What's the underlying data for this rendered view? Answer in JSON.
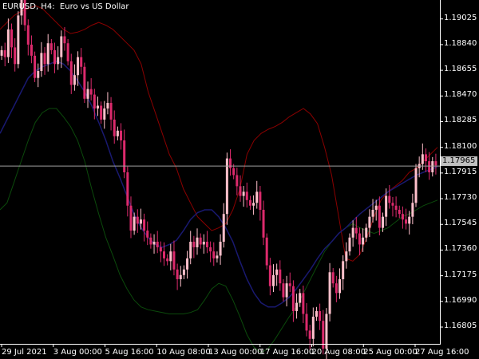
{
  "chart_title": {
    "symbol_tf": "EURUSD, H4:",
    "description": "Euro vs US Dollar"
  },
  "current_price": "1.17965",
  "colors": {
    "background": "#000000",
    "bull_candle": "#ffc0cb",
    "bear_candle": "#dc2a6c",
    "middle_band": "#191970",
    "upper_band": "#8b0000",
    "lower_band": "#0b4a0b",
    "price_line": "#a0a0a0",
    "axis": "#ffffff"
  },
  "chart_data": {
    "type": "candlestick",
    "indicator": "Bollinger Bands",
    "y_ticks": [
      "1.19025",
      "1.18840",
      "1.18655",
      "1.18470",
      "1.18285",
      "1.18100",
      "1.17915",
      "1.17730",
      "1.17545",
      "1.17360",
      "1.17175",
      "1.16990",
      "1.16805"
    ],
    "x_ticks": [
      "29 Jul 2021",
      "3 Aug 00:00",
      "5 Aug 16:00",
      "10 Aug 08:00",
      "13 Aug 00:00",
      "17 Aug 16:00",
      "20 Aug 08:00",
      "25 Aug 00:00",
      "27 Aug 16:00"
    ],
    "ylim": [
      1.1669,
      1.1915
    ],
    "close": [
      1.188,
      1.1875,
      1.1895,
      1.1882,
      1.187,
      1.1905,
      1.1918,
      1.1898,
      1.1884,
      1.1876,
      1.186,
      1.1865,
      1.1878,
      1.187,
      1.1885,
      1.188,
      1.187,
      1.1875,
      1.189,
      1.1885,
      1.1872,
      1.1855,
      1.1862,
      1.1875,
      1.1868,
      1.1845,
      1.1852,
      1.1848,
      1.1838,
      1.184,
      1.183,
      1.1838,
      1.1842,
      1.183,
      1.1818,
      1.1822,
      1.1815,
      1.1792,
      1.1768,
      1.175,
      1.176,
      1.1755,
      1.1758,
      1.175,
      1.1745,
      1.174,
      1.1742,
      1.1738,
      1.1735,
      1.173,
      1.1728,
      1.1735,
      1.1722,
      1.1715,
      1.1718,
      1.1722,
      1.173,
      1.1742,
      1.1738,
      1.1745,
      1.174,
      1.1742,
      1.1738,
      1.1735,
      1.173,
      1.1732,
      1.1742,
      1.1762,
      1.1802,
      1.1795,
      1.179,
      1.1782,
      1.1775,
      1.1778,
      1.1772,
      1.1768,
      1.177,
      1.1778,
      1.1765,
      1.1745,
      1.1725,
      1.171,
      1.1718,
      1.1722,
      1.1712,
      1.1702,
      1.1712,
      1.171,
      1.1692,
      1.1698,
      1.1705,
      1.169,
      1.1678,
      1.1672,
      1.1688,
      1.1692,
      1.1685,
      1.1665,
      1.169,
      1.172,
      1.1712,
      1.1705,
      1.1715,
      1.1728,
      1.1735,
      1.1745,
      1.1752,
      1.1748,
      1.174,
      1.1745,
      1.1752,
      1.176,
      1.1765,
      1.1768,
      1.1752,
      1.176,
      1.1775,
      1.177,
      1.1768,
      1.1765,
      1.1762,
      1.1758,
      1.1755,
      1.176,
      1.177,
      1.1795,
      1.1798,
      1.1805,
      1.18,
      1.1792,
      1.18,
      1.1797
    ],
    "bands": {
      "upper": [
        1.1895,
        1.19,
        1.1905,
        1.1908,
        1.191,
        1.1912,
        1.191,
        1.1905,
        1.19,
        1.1895,
        1.1892,
        1.1893,
        1.1895,
        1.1898,
        1.19,
        1.1898,
        1.1895,
        1.189,
        1.1885,
        1.188,
        1.187,
        1.185,
        1.1835,
        1.182,
        1.1805,
        1.1795,
        1.178,
        1.177,
        1.176,
        1.1755,
        1.175,
        1.1752,
        1.1755,
        1.1765,
        1.178,
        1.1805,
        1.1815,
        1.182,
        1.1823,
        1.1825,
        1.1828,
        1.1832,
        1.1835,
        1.1838,
        1.1834,
        1.1827,
        1.181,
        1.179,
        1.176,
        1.173,
        1.1728,
        1.1733,
        1.1745,
        1.176,
        1.1772,
        1.1778,
        1.1782,
        1.1786,
        1.1792,
        1.1795,
        1.18,
        1.1805,
        1.181
      ],
      "middle": [
        1.182,
        1.183,
        1.184,
        1.185,
        1.186,
        1.1865,
        1.1868,
        1.187,
        1.1872,
        1.187,
        1.1865,
        1.1858,
        1.185,
        1.184,
        1.1828,
        1.1815,
        1.18,
        1.1788,
        1.1775,
        1.1762,
        1.1752,
        1.1745,
        1.174,
        1.1738,
        1.174,
        1.1743,
        1.175,
        1.1758,
        1.1763,
        1.1765,
        1.1765,
        1.176,
        1.1752,
        1.1742,
        1.1728,
        1.1715,
        1.1705,
        1.1698,
        1.1695,
        1.1695,
        1.1698,
        1.1702,
        1.1708,
        1.1715,
        1.1722,
        1.173,
        1.1737,
        1.1742,
        1.1748,
        1.1752,
        1.1757,
        1.1762,
        1.1766,
        1.177,
        1.1774,
        1.1778,
        1.1781,
        1.1784,
        1.1787,
        1.179,
        1.1792,
        1.1794,
        1.1796
      ],
      "lower": [
        1.1765,
        1.177,
        1.1785,
        1.18,
        1.1815,
        1.1828,
        1.1835,
        1.1838,
        1.1838,
        1.1832,
        1.1825,
        1.1815,
        1.18,
        1.178,
        1.1762,
        1.1745,
        1.1732,
        1.1718,
        1.1708,
        1.17,
        1.1695,
        1.1693,
        1.1692,
        1.1691,
        1.169,
        1.169,
        1.169,
        1.1691,
        1.1693,
        1.17,
        1.1708,
        1.1712,
        1.171,
        1.17,
        1.1688,
        1.1675,
        1.1666,
        1.1662,
        1.1665,
        1.1672,
        1.168,
        1.1688,
        1.1695,
        1.1705,
        1.1715,
        1.1725,
        1.1735,
        1.1742,
        1.1748,
        1.1752,
        1.1755,
        1.1752,
        1.175,
        1.1748,
        1.175,
        1.1752,
        1.1756,
        1.176,
        1.1762,
        1.1765,
        1.1768,
        1.177,
        1.1772
      ]
    }
  }
}
